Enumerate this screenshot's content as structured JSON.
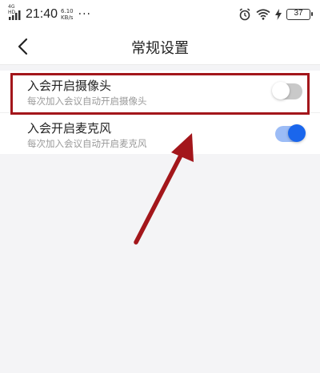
{
  "status_bar": {
    "signal_label": "4G HD",
    "time": "21:40",
    "net_speed_value": "6.10",
    "net_speed_unit": "KB/s",
    "more": "···",
    "battery": "37"
  },
  "nav": {
    "title": "常规设置"
  },
  "settings": [
    {
      "title": "入会开启摄像头",
      "description": "每次加入会议自动开启摄像头",
      "enabled": false
    },
    {
      "title": "入会开启麦克风",
      "description": "每次加入会议自动开启麦克风",
      "enabled": true
    }
  ],
  "colors": {
    "annotation": "#a3161b",
    "toggle_on": "#1a66ec",
    "toggle_off": "#c9c9c9"
  }
}
